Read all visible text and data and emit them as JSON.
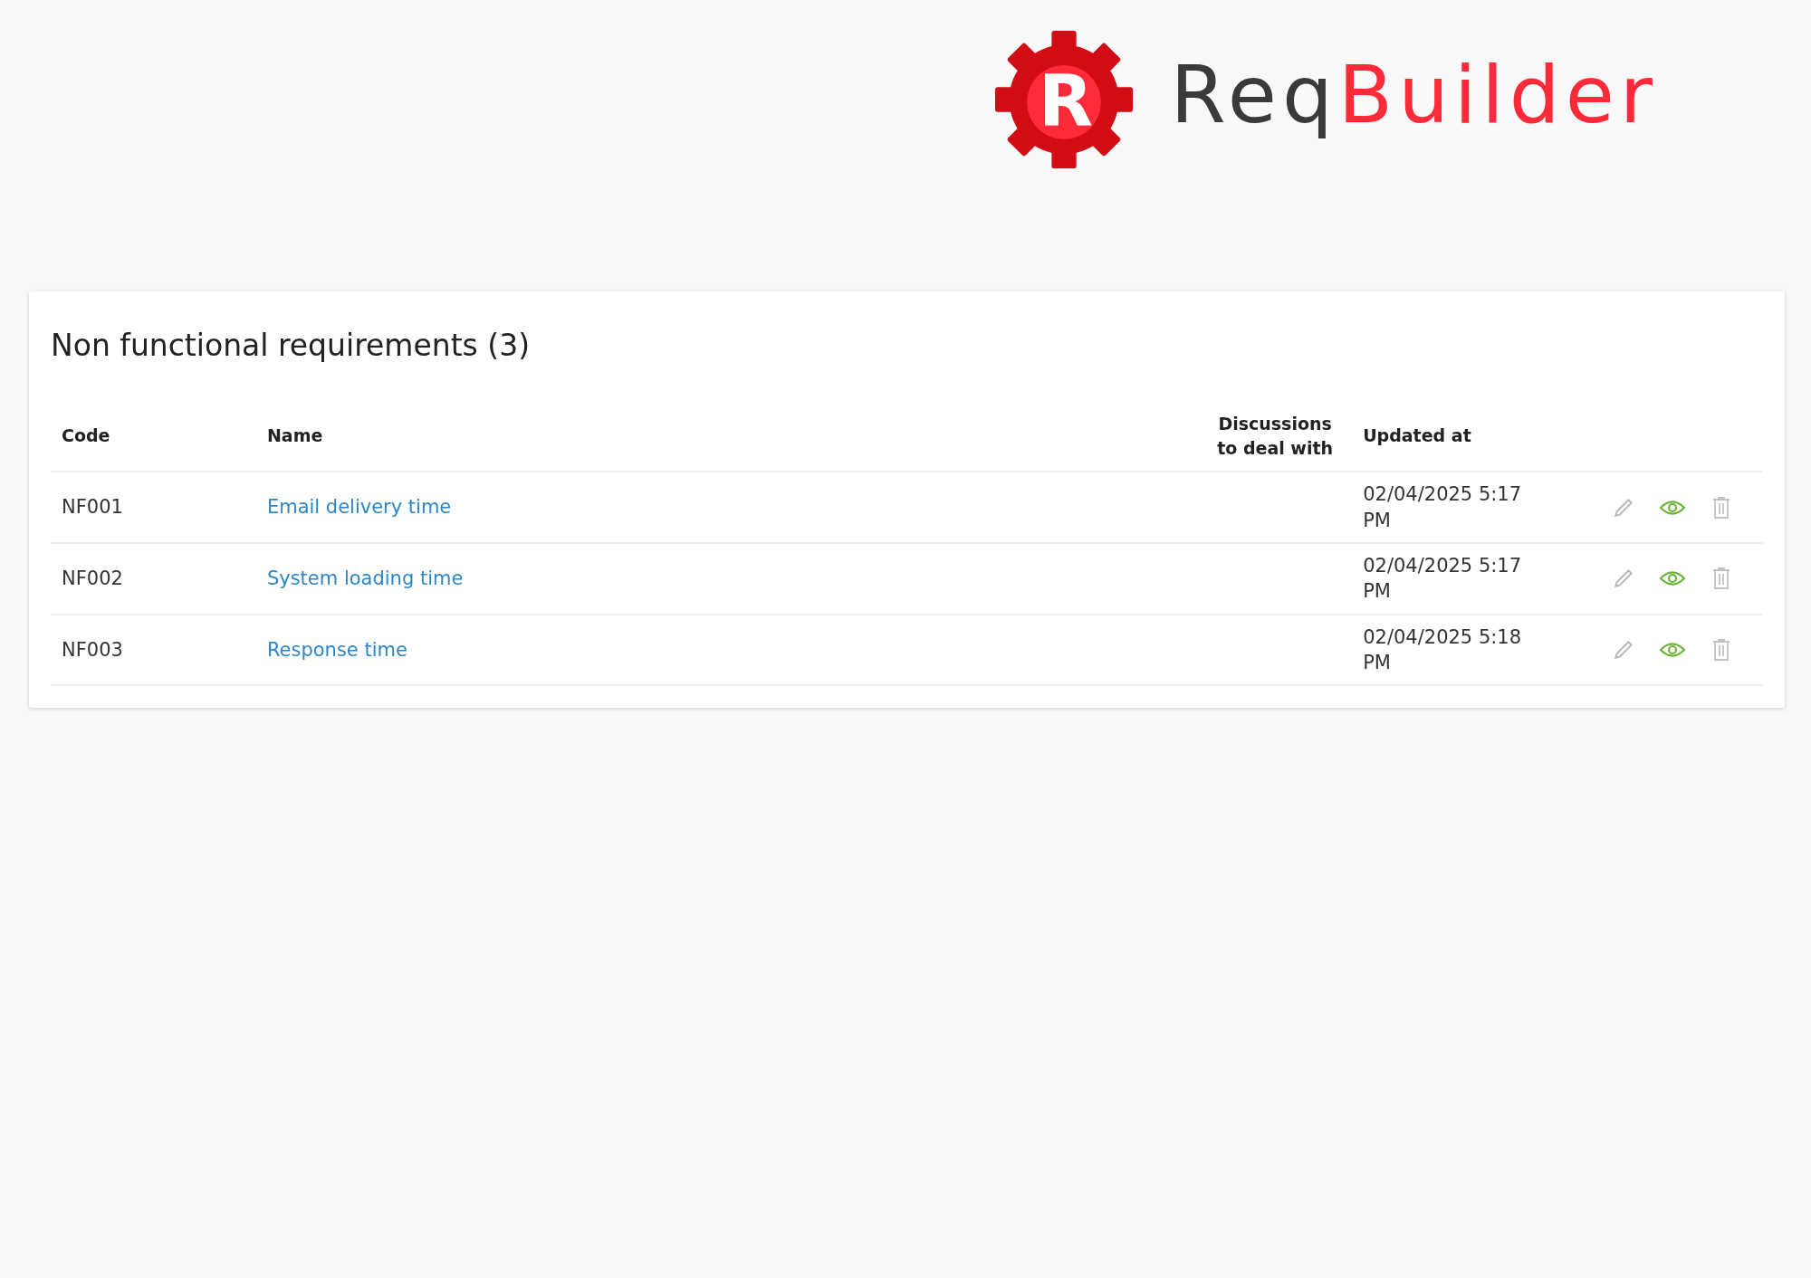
{
  "logo": {
    "mark_letter": "R",
    "name_start": "Req",
    "name_end": "Builder"
  },
  "panel": {
    "title": "Non functional requirements (3)",
    "table": {
      "columns": [
        "Code",
        "Name",
        "Discussions to deal with",
        "Updated at"
      ],
      "rows": [
        {
          "code": "NF001",
          "name": "Email delivery time",
          "updated_at": "02/04/2025 5:17 PM"
        },
        {
          "code": "NF002",
          "name": "System loading time",
          "updated_at": "02/04/2025 5:17 PM"
        },
        {
          "code": "NF003",
          "name": "Response time",
          "updated_at": "02/04/2025 5:18 PM"
        }
      ]
    }
  }
}
